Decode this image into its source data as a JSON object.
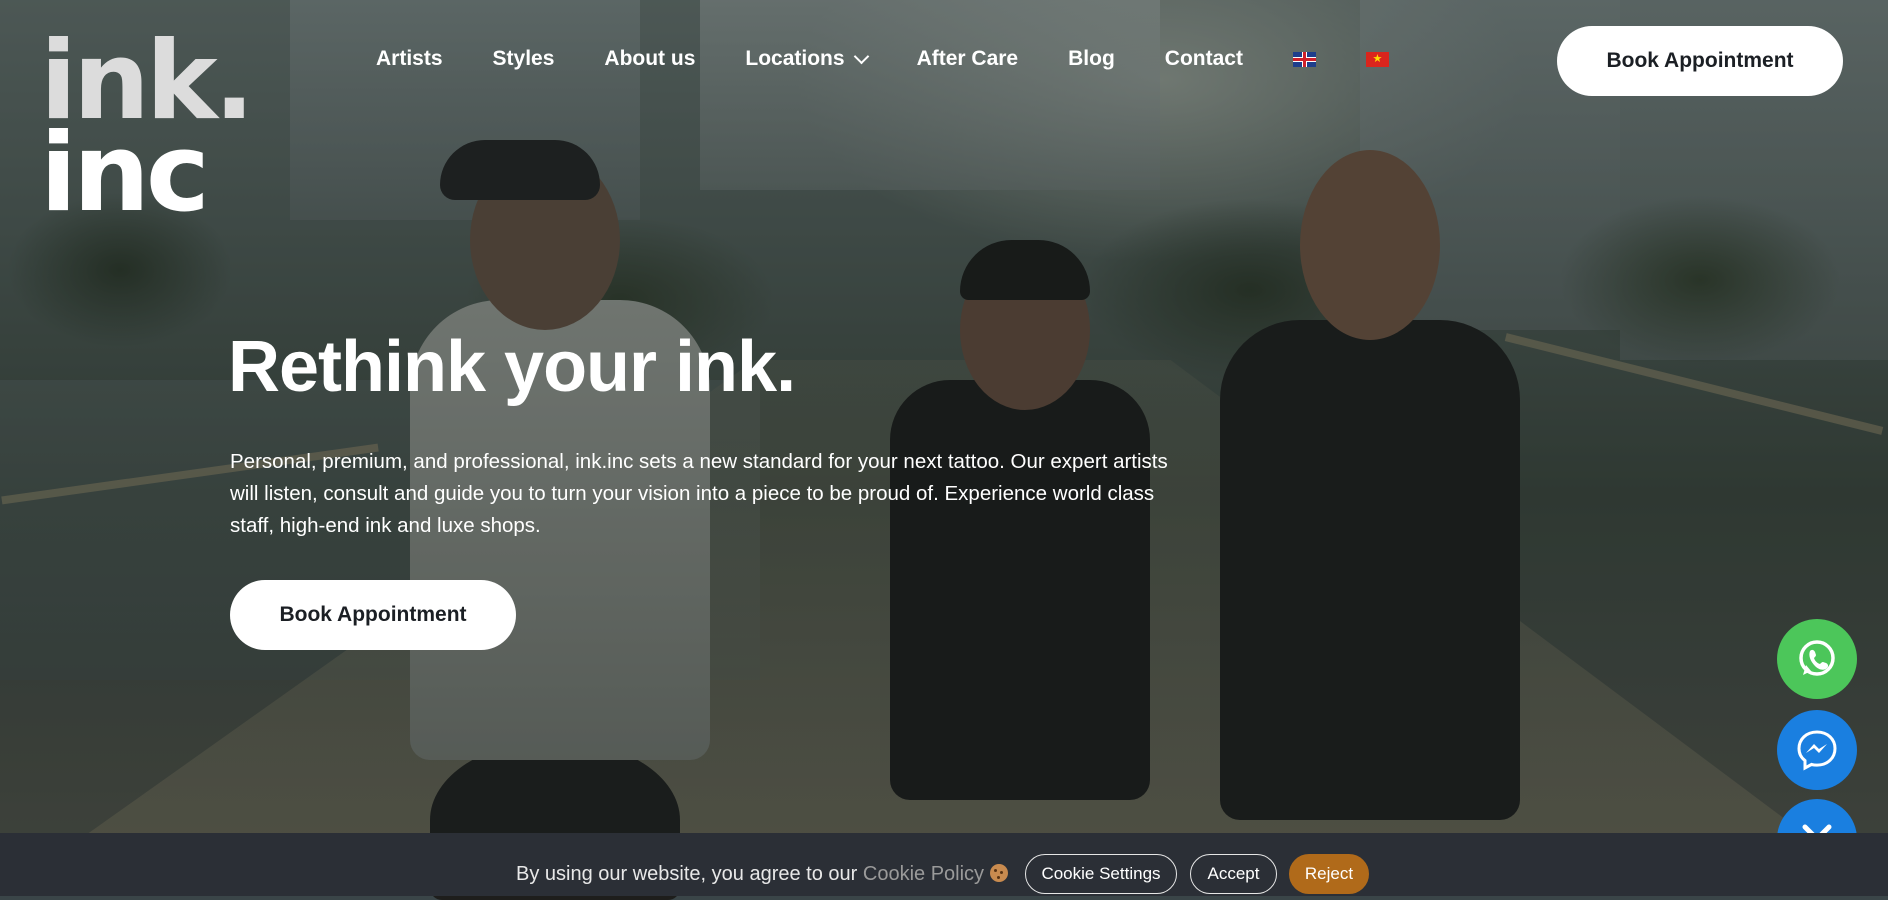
{
  "brand": {
    "logo_line1": "ink.",
    "logo_line2": "inc"
  },
  "nav": {
    "items": [
      {
        "label": "Artists"
      },
      {
        "label": "Styles"
      },
      {
        "label": "About us"
      },
      {
        "label": "Locations",
        "has_dropdown": true
      },
      {
        "label": "After Care"
      },
      {
        "label": "Blog"
      },
      {
        "label": "Contact"
      }
    ],
    "languages": [
      {
        "name": "English",
        "icon": "uk-flag-icon"
      },
      {
        "name": "Vietnamese",
        "icon": "vn-flag-icon"
      }
    ],
    "book_label": "Book Appointment"
  },
  "hero": {
    "title": "Rethink your ink.",
    "text": "Personal, premium, and professional, ink.inc sets a new standard for your next tattoo. Our expert artists will listen, consult and guide you to turn your vision into a piece to be proud of. Experience world class staff, high-end ink and luxe shops.",
    "book_label": "Book Appointment"
  },
  "floating_buttons": [
    {
      "icon": "whatsapp-icon",
      "color": "#4cc65a"
    },
    {
      "icon": "messenger-icon",
      "color": "#1a7fe0"
    },
    {
      "icon": "close-icon",
      "color": "#1a7fe0"
    }
  ],
  "cookie_bar": {
    "text": "By using our website, you agree to our ",
    "link_label": "Cookie Policy",
    "settings_label": "Cookie Settings",
    "accept_label": "Accept",
    "reject_label": "Reject",
    "reject_color": "#b06a1a"
  }
}
